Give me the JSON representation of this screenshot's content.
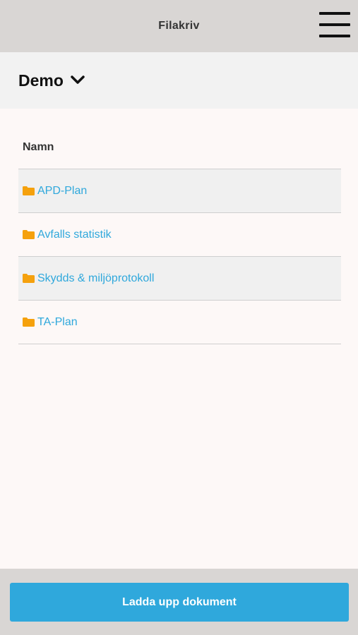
{
  "app": {
    "title": "Filakriv"
  },
  "icons": {
    "menu": "hamburger-icon",
    "dropdown": "chevron-down-icon",
    "folder": "folder-icon"
  },
  "project": {
    "name": "Demo"
  },
  "table": {
    "column_header": "Namn",
    "rows": [
      {
        "label": "APD-Plan"
      },
      {
        "label": "Avfalls statistik"
      },
      {
        "label": "Skydds & miljöprotokoll"
      },
      {
        "label": "TA-Plan"
      }
    ]
  },
  "footer": {
    "upload_label": "Ladda upp dokument"
  },
  "colors": {
    "accent": "#2fa8dc",
    "folder": "#f5a10d",
    "topbar": "#d9d6d4"
  }
}
